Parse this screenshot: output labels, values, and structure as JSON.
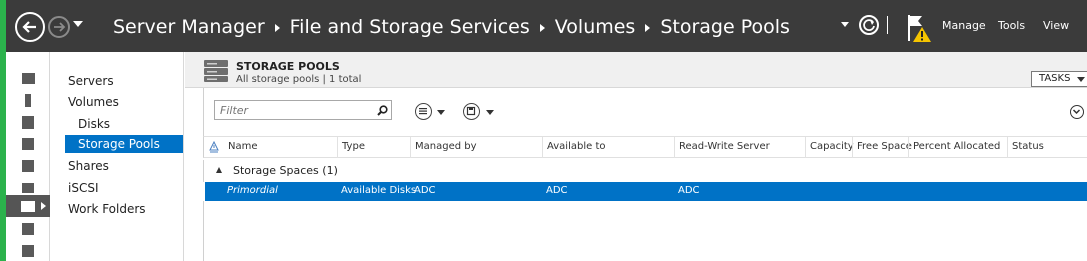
{
  "titlebar": {
    "breadcrumb": [
      "Server Manager",
      "File and Storage Services",
      "Volumes",
      "Storage Pools"
    ],
    "menu": {
      "manage": "Manage",
      "tools": "Tools",
      "view": "View"
    },
    "icons": {
      "back": "back-arrow-icon",
      "forward": "forward-arrow-icon",
      "refresh": "refresh-icon",
      "flag": "notification-flag-icon"
    }
  },
  "rail": {
    "items": [
      "dashboard-icon",
      "local-server-icon",
      "all-servers-icon",
      "adds-icon",
      "dhcp-icon",
      "dns-icon",
      "file-storage-icon",
      "iis-icon",
      "server-role-icon"
    ],
    "active_index": 6
  },
  "navtree": {
    "items": [
      {
        "label": "Servers",
        "level": 0
      },
      {
        "label": "Volumes",
        "level": 0
      },
      {
        "label": "Disks",
        "level": 1
      },
      {
        "label": "Storage Pools",
        "level": 1,
        "selected": true
      },
      {
        "label": "Shares",
        "level": 0
      },
      {
        "label": "iSCSI",
        "level": 0
      },
      {
        "label": "Work Folders",
        "level": 0
      }
    ]
  },
  "main": {
    "title": "STORAGE POOLS",
    "subtitle": "All storage pools | 1 total",
    "tasks_label": "TASKS",
    "filter_placeholder": "Filter",
    "columns": [
      "Name",
      "Type",
      "Managed by",
      "Available to",
      "Read-Write Server",
      "Capacity",
      "Free Space",
      "Percent Allocated",
      "Status"
    ],
    "group": {
      "label": "Storage Spaces (1)"
    },
    "rows": [
      {
        "name": "Primordial",
        "type": "Available Disks",
        "managed_by": "ADC",
        "available_to": "ADC",
        "rw_server": "ADC",
        "capacity": "",
        "free_space": "",
        "percent_allocated": "",
        "status": ""
      }
    ]
  },
  "colors": {
    "accent": "#0072c6",
    "titlebar": "#3b3b3b",
    "green_edge": "#2bb24c",
    "warning": "#f5c400"
  }
}
